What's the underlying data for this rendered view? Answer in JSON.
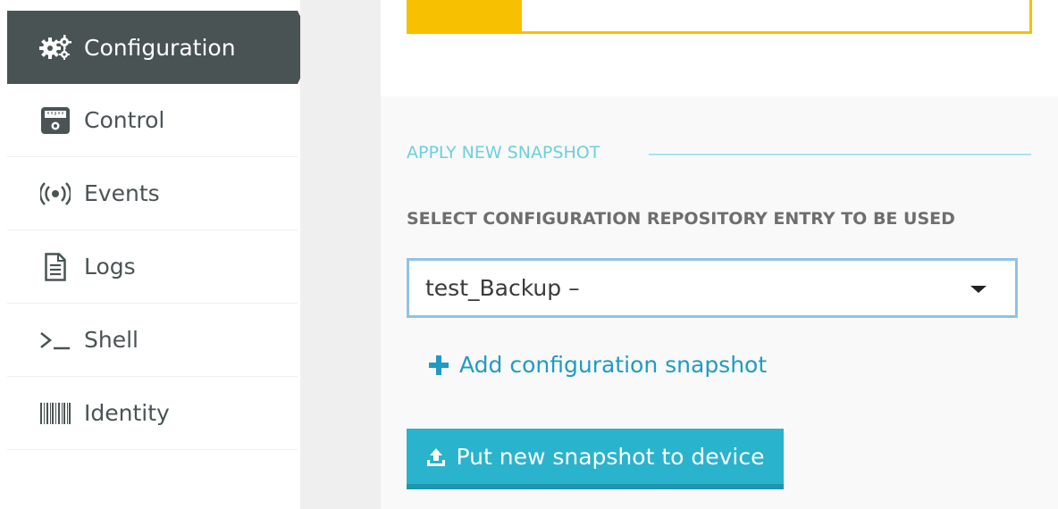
{
  "sidebar": {
    "items": [
      {
        "label": "Configuration",
        "icon": "gears-icon",
        "active": true
      },
      {
        "label": "Control",
        "icon": "control-panel-icon",
        "active": false
      },
      {
        "label": "Events",
        "icon": "broadcast-icon",
        "active": false
      },
      {
        "label": "Logs",
        "icon": "document-icon",
        "active": false
      },
      {
        "label": "Shell",
        "icon": "terminal-prompt-icon",
        "active": false
      },
      {
        "label": "Identity",
        "icon": "barcode-icon",
        "active": false
      }
    ]
  },
  "main": {
    "section_title": "APPLY NEW SNAPSHOT",
    "field_label": "SELECT CONFIGURATION REPOSITORY ENTRY TO BE USED",
    "select": {
      "value": "test_Backup –"
    },
    "add_link": {
      "label": "Add configuration snapshot",
      "icon": "plus-icon"
    },
    "put_button": {
      "label": "Put new snapshot to device",
      "icon": "upload-icon"
    }
  },
  "colors": {
    "sidebar_active": "#4a5353",
    "accent_yellow": "#f7c000",
    "section_title": "#6ccfe0",
    "link": "#1f9bc2",
    "button": "#2ab3cc",
    "select_border": "#8fc3e8"
  }
}
